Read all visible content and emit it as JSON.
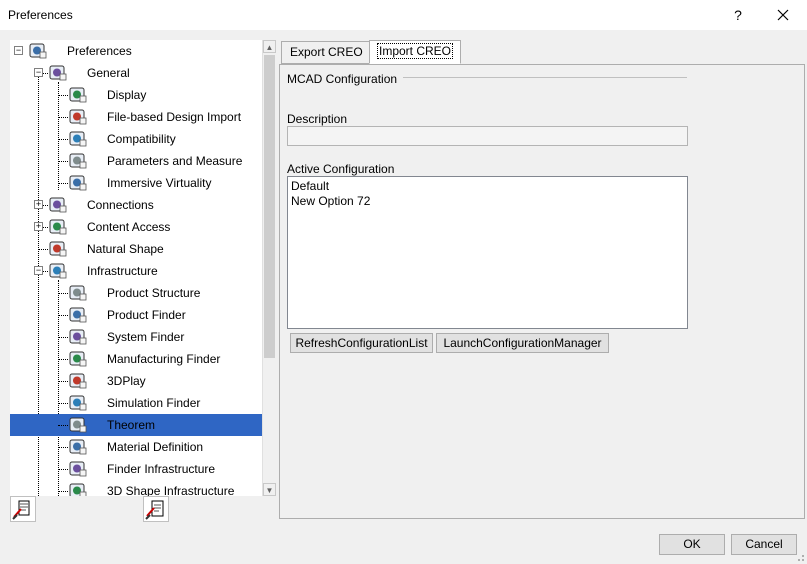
{
  "window": {
    "title": "Preferences",
    "help_label": "?",
    "close_label": "✕"
  },
  "tree": {
    "items": [
      {
        "label": "Preferences",
        "icon": "preferences-icon",
        "level": 0,
        "expanded": true
      },
      {
        "label": "General",
        "icon": "general-icon",
        "level": 1,
        "expanded": true
      },
      {
        "label": "Display",
        "icon": "display-icon",
        "level": 2
      },
      {
        "label": "File-based Design Import",
        "icon": "file-import-icon",
        "level": 2
      },
      {
        "label": "Compatibility",
        "icon": "compatibility-icon",
        "level": 2
      },
      {
        "label": "Parameters and Measure",
        "icon": "parameters-icon",
        "level": 2
      },
      {
        "label": "Immersive Virtuality",
        "icon": "immersive-icon",
        "level": 2
      },
      {
        "label": "Connections",
        "icon": "connections-icon",
        "level": 1,
        "expanded": false
      },
      {
        "label": "Content Access",
        "icon": "content-access-icon",
        "level": 1,
        "expanded": false
      },
      {
        "label": "Natural Shape",
        "icon": "natural-shape-icon",
        "level": 1
      },
      {
        "label": "Infrastructure",
        "icon": "infrastructure-icon",
        "level": 1,
        "expanded": true
      },
      {
        "label": "Product Structure",
        "icon": "product-structure-icon",
        "level": 2
      },
      {
        "label": "Product Finder",
        "icon": "product-finder-icon",
        "level": 2
      },
      {
        "label": "System Finder",
        "icon": "system-finder-icon",
        "level": 2
      },
      {
        "label": "Manufacturing Finder",
        "icon": "manufacturing-finder-icon",
        "level": 2
      },
      {
        "label": "3DPlay",
        "icon": "3dplay-icon",
        "level": 2
      },
      {
        "label": "Simulation Finder",
        "icon": "simulation-finder-icon",
        "level": 2
      },
      {
        "label": "Theorem",
        "icon": "theorem-icon",
        "level": 2,
        "selected": true
      },
      {
        "label": "Material Definition",
        "icon": "material-definition-icon",
        "level": 2
      },
      {
        "label": "Finder Infrastructure",
        "icon": "finder-infrastructure-icon",
        "level": 2
      },
      {
        "label": "3D Shape Infrastructure",
        "icon": "3d-shape-infrastructure-icon",
        "level": 2
      }
    ]
  },
  "tabs": [
    {
      "label": "Export CREO",
      "active": false
    },
    {
      "label": "Import CREO",
      "active": true
    }
  ],
  "panel": {
    "group_title": "MCAD Configuration",
    "description_label": "Description",
    "description_value": "",
    "active_config_label": "Active Configuration",
    "configurations": [
      "Default",
      "New Option 72"
    ],
    "refresh_button": "RefreshConfigurationList",
    "launch_button": "LaunchConfigurationManager"
  },
  "footer": {
    "ok_label": "OK",
    "cancel_label": "Cancel"
  },
  "colors": {
    "selection": "#2f66c4",
    "background": "#f0f0f0"
  }
}
